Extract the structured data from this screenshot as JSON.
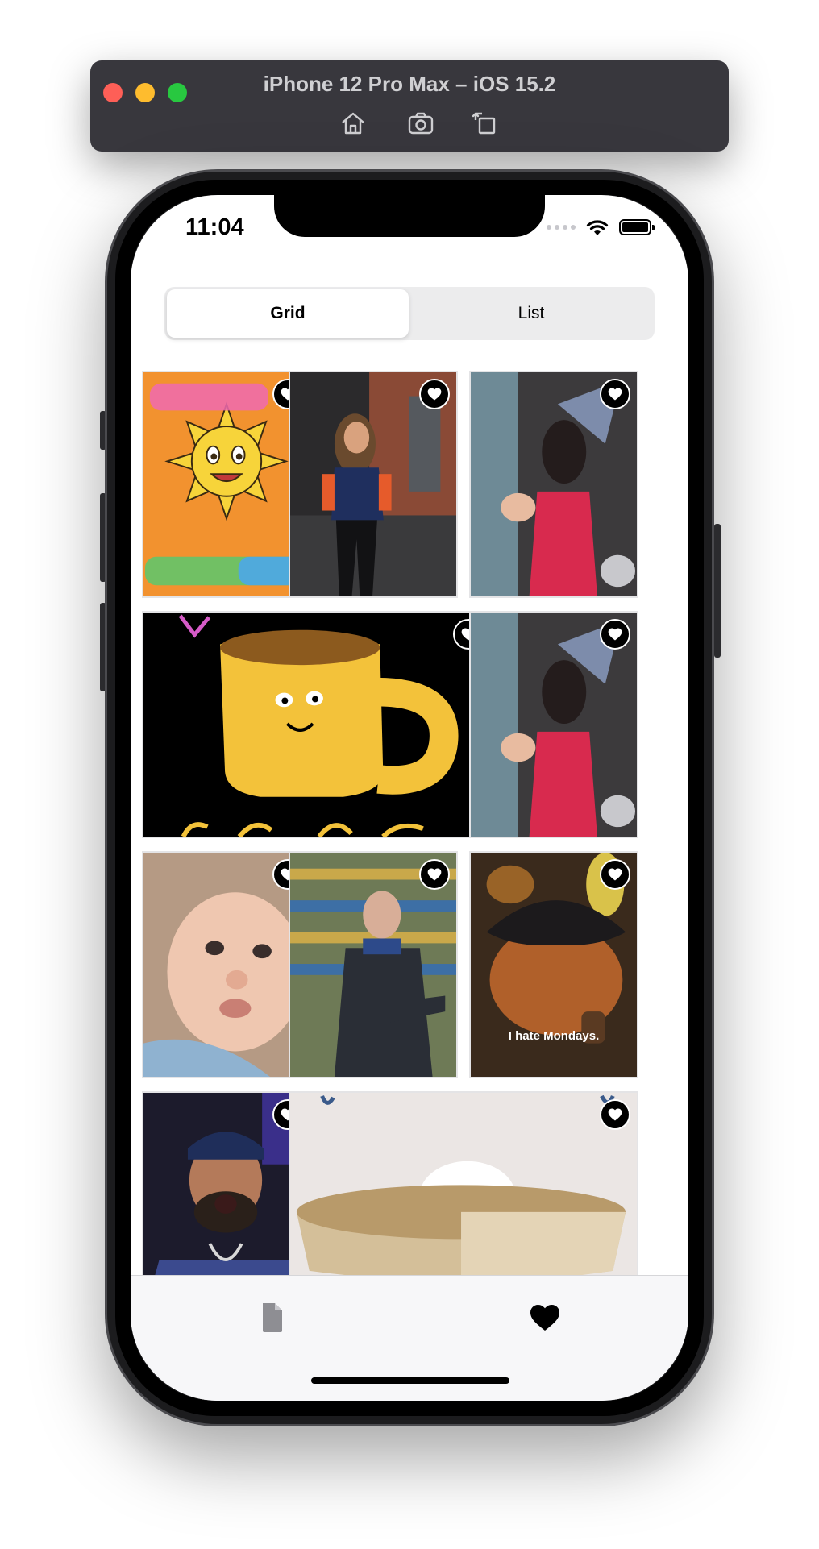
{
  "simulator": {
    "title": "iPhone 12 Pro Max – iOS 15.2",
    "tools": [
      {
        "icon": "home-icon"
      },
      {
        "icon": "screenshot-icon"
      },
      {
        "icon": "rotate-icon"
      }
    ]
  },
  "status_bar": {
    "time": "11:04",
    "icons": [
      "signal-dots-icon",
      "wifi-icon",
      "battery-icon"
    ],
    "battery_level": 1.0
  },
  "segmented": {
    "options": [
      "Grid",
      "List"
    ],
    "selected": "Grid"
  },
  "grid": {
    "items": [
      {
        "name": "today-new-day-gif",
        "favorited": true
      },
      {
        "name": "woman-walking-gif",
        "favorited": true
      },
      {
        "name": "party-hat-girl-gif",
        "favorited": true
      },
      {
        "name": "coffee-mug-gif",
        "favorited": true
      },
      {
        "name": "party-hat-girl-gif",
        "favorited": true
      },
      {
        "name": "baby-face-gif",
        "favorited": true
      },
      {
        "name": "coach-gesturing-gif",
        "favorited": true
      },
      {
        "name": "puss-in-boots-gif",
        "favorited": true,
        "caption": "I hate Mondays."
      },
      {
        "name": "laughing-man-gif",
        "favorited": true
      },
      {
        "name": "cat-in-bowl-gif",
        "favorited": true
      }
    ]
  },
  "tab_bar": {
    "tabs": [
      {
        "icon": "document-icon",
        "active": false
      },
      {
        "icon": "heart-icon",
        "active": true
      }
    ]
  },
  "colors": {
    "accent": "#000000",
    "inactive_tab": "#8e8e93",
    "window_bar": "#38373d"
  }
}
